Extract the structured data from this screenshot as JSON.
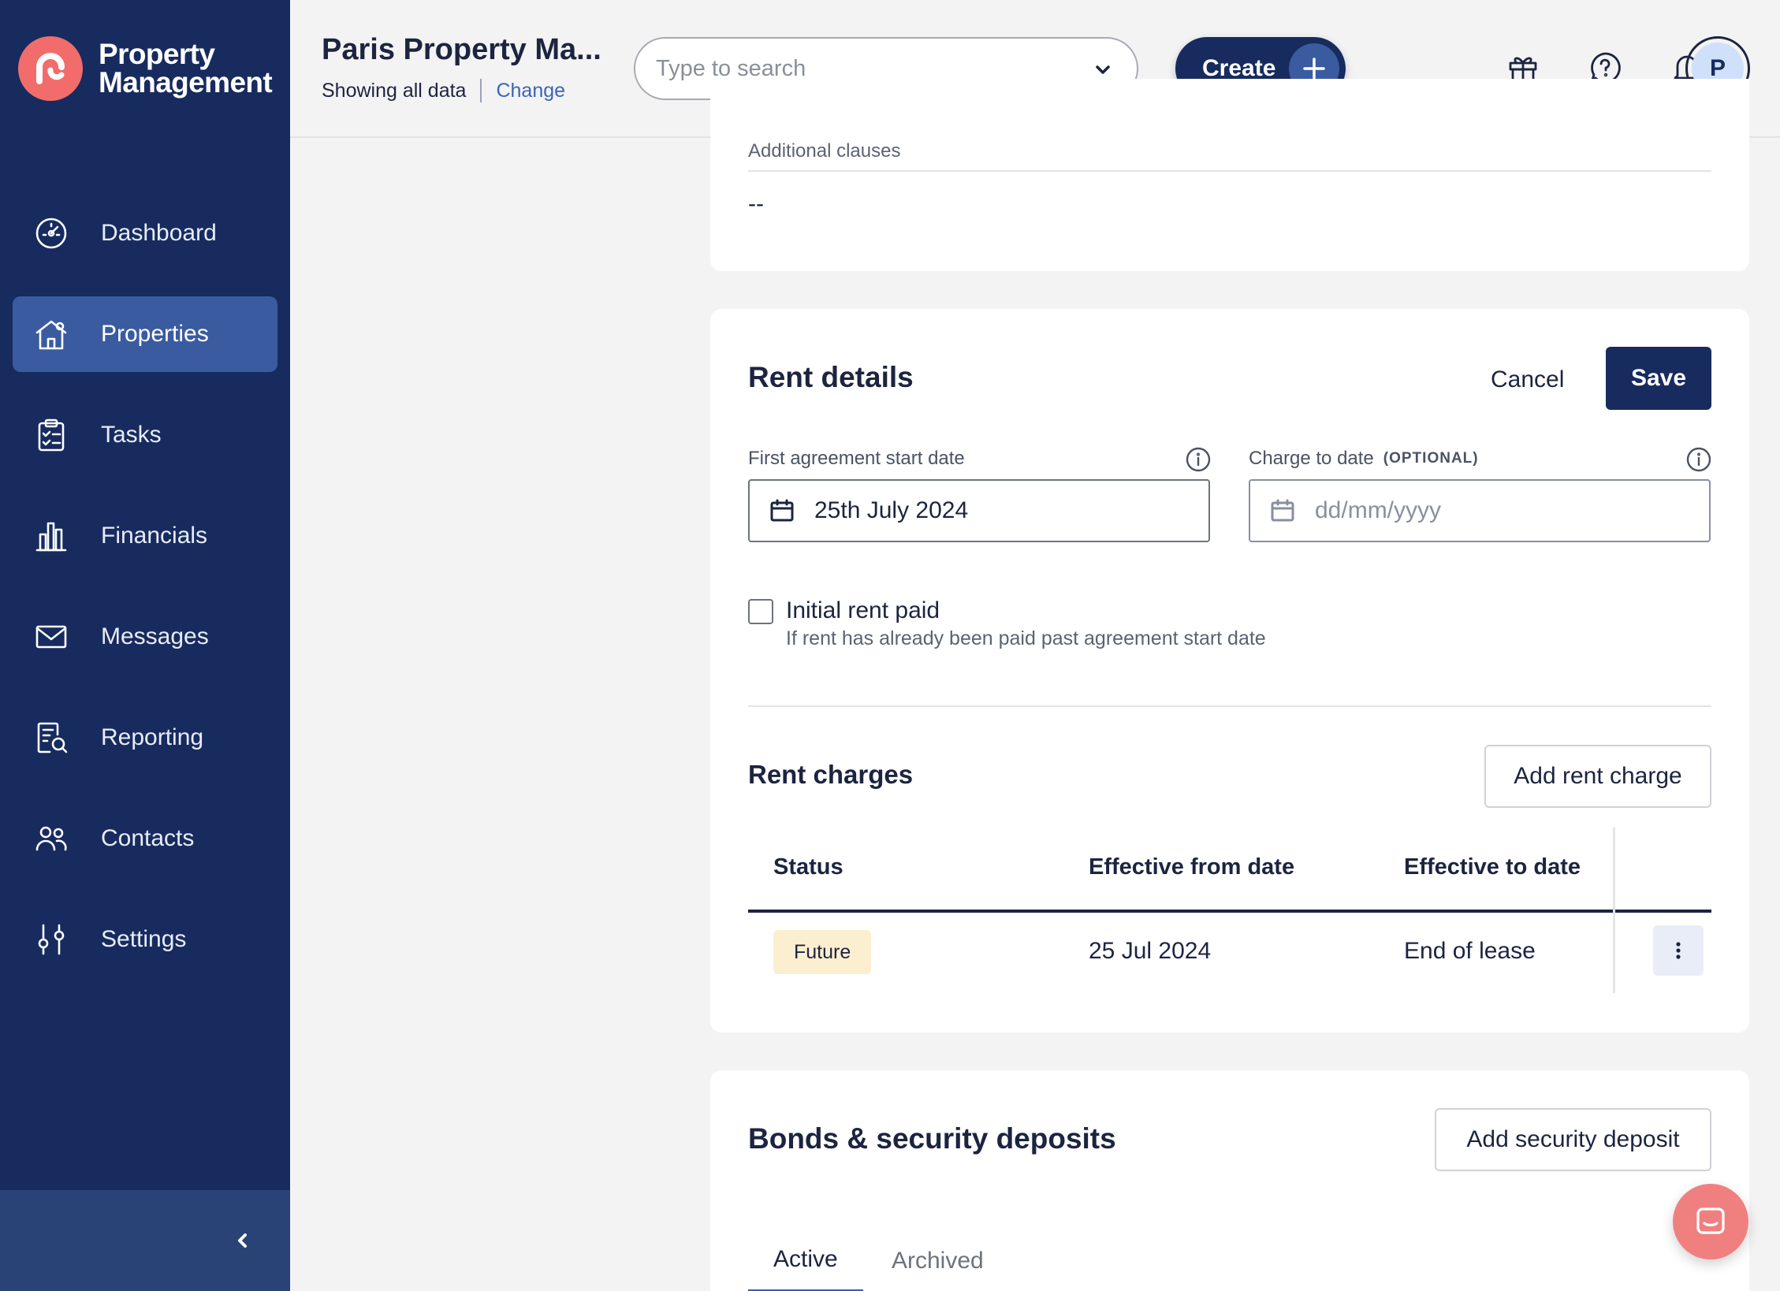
{
  "brand": {
    "line1": "Property",
    "line2": "Management",
    "color": "#f26c6c"
  },
  "sidebar": {
    "items": [
      {
        "label": "Dashboard",
        "icon": "dashboard-gauge-icon"
      },
      {
        "label": "Properties",
        "icon": "house-icon",
        "active": true
      },
      {
        "label": "Tasks",
        "icon": "clipboard-checklist-icon"
      },
      {
        "label": "Financials",
        "icon": "bar-chart-icon"
      },
      {
        "label": "Messages",
        "icon": "envelope-icon"
      },
      {
        "label": "Reporting",
        "icon": "report-search-icon"
      },
      {
        "label": "Contacts",
        "icon": "people-icon"
      },
      {
        "label": "Settings",
        "icon": "sliders-icon"
      }
    ],
    "collapse_icon": "chevron-left-icon"
  },
  "header": {
    "org_name": "Paris Property Ma...",
    "showing": "Showing all data",
    "change": "Change",
    "search_placeholder": "Type to search",
    "create_label": "Create",
    "icons": [
      "gift-icon",
      "help-icon",
      "bell-icon"
    ],
    "avatar_initial": "P"
  },
  "additional_clauses": {
    "label": "Additional clauses",
    "value": "--"
  },
  "rent_details": {
    "title": "Rent details",
    "cancel": "Cancel",
    "save": "Save",
    "first_start_label": "First agreement start date",
    "first_start_value": "25th July 2024",
    "charge_to_label": "Charge to date",
    "charge_to_optional": "(OPTIONAL)",
    "charge_to_placeholder": "dd/mm/yyyy",
    "initial_rent_label": "Initial rent paid",
    "initial_rent_help": "If rent has already been paid past agreement start date",
    "initial_rent_checked": false
  },
  "rent_charges": {
    "title": "Rent charges",
    "add_button": "Add rent charge",
    "columns": [
      "Status",
      "Effective from date",
      "Effective to date"
    ],
    "rows": [
      {
        "status": "Future",
        "from": "25 Jul 2024",
        "to": "End of lease"
      }
    ]
  },
  "bonds": {
    "title": "Bonds & security deposits",
    "add_button": "Add security deposit",
    "tabs": [
      "Active",
      "Archived"
    ],
    "active_tab": "Active"
  },
  "colors": {
    "navy": "#172b5f",
    "accent": "#3a5ba0",
    "badge_future": "#fbefd0"
  }
}
